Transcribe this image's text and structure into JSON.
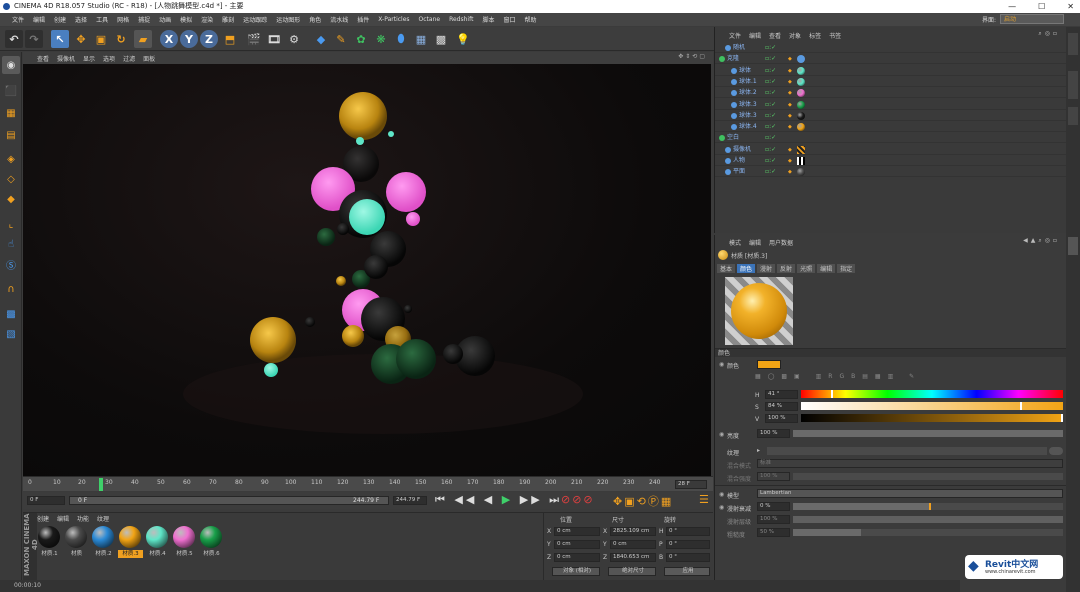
{
  "window": {
    "title": "CINEMA 4D R18.057 Studio (RC - R18) - [人物跳舞模型.c4d *] - 主要",
    "controls": [
      "—",
      "☐",
      "✕"
    ]
  },
  "menu": {
    "items": [
      "文件",
      "编辑",
      "创建",
      "选择",
      "工具",
      "网格",
      "捕捉",
      "动画",
      "模拟",
      "渲染",
      "雕刻",
      "运动跟踪",
      "运动图形",
      "角色",
      "流水线",
      "插件",
      "X-Particles",
      "Octane",
      "Redshift",
      "脚本",
      "窗口",
      "帮助"
    ],
    "interface_label": "界面:",
    "interface_value": "启动"
  },
  "viewport": {
    "menu": [
      "查看",
      "摄像机",
      "显示",
      "选项",
      "过滤",
      "面板"
    ]
  },
  "timeline": {
    "ticks": [
      "0",
      "10",
      "20",
      "30",
      "40",
      "50",
      "60",
      "70",
      "80",
      "90",
      "100",
      "110",
      "120",
      "130",
      "140",
      "150",
      "160",
      "170",
      "180",
      "190",
      "200",
      "210",
      "220",
      "230",
      "240"
    ],
    "current_frame": "28 F"
  },
  "transport": {
    "start_field": "0 F",
    "min_field": "0 F",
    "range_end": "244.79 F",
    "end_field": "244.79 F"
  },
  "materials": {
    "menu": [
      "创建",
      "编辑",
      "功能",
      "纹理"
    ],
    "items": [
      {
        "label": "材质.1",
        "color": "#1a1a1a",
        "selected": false
      },
      {
        "label": "材质",
        "color": "#4a4a4a",
        "selected": false
      },
      {
        "label": "材质.2",
        "color": "#2b8ad6",
        "selected": false
      },
      {
        "label": "材质.3",
        "color": "#f2a415",
        "selected": true
      },
      {
        "label": "材质.4",
        "color": "#5fe6c8",
        "selected": false
      },
      {
        "label": "材质.5",
        "color": "#f070d0",
        "selected": false
      },
      {
        "label": "材质.6",
        "color": "#19a04a",
        "selected": false
      }
    ],
    "brand_top": "MAXON",
    "brand_bottom": "CINEMA 4D"
  },
  "coords": {
    "headers": [
      "位置",
      "尺寸",
      "旋转"
    ],
    "rows": [
      {
        "axis": "X",
        "pos": "0 cm",
        "size_axis": "X",
        "size": "2825.109 cm",
        "rot_axis": "H",
        "rot": "0 °"
      },
      {
        "axis": "Y",
        "pos": "0 cm",
        "size_axis": "Y",
        "size": "0 cm",
        "rot_axis": "P",
        "rot": "0 °"
      },
      {
        "axis": "Z",
        "pos": "0 cm",
        "size_axis": "Z",
        "size": "1840.653 cm",
        "rot_axis": "B",
        "rot": "0 °"
      }
    ],
    "mode": "对象 (相对)",
    "size_mode": "绝对尺寸",
    "apply": "应用"
  },
  "status": {
    "time": "00:00:10"
  },
  "objects": {
    "menu": [
      "文件",
      "编辑",
      "查看",
      "对象",
      "标签",
      "书签"
    ],
    "items": [
      {
        "name": "随机",
        "indent": 1,
        "tag": "none"
      },
      {
        "name": "克隆",
        "indent": 0,
        "tag": "blue"
      },
      {
        "name": "球体",
        "indent": 2,
        "tag": "#5fe6c8"
      },
      {
        "name": "球体.1",
        "indent": 2,
        "tag": "#5fe6c8"
      },
      {
        "name": "球体.2",
        "indent": 2,
        "tag": "#f070d0"
      },
      {
        "name": "球体.3",
        "indent": 2,
        "tag": "#19a04a"
      },
      {
        "name": "球体.3",
        "indent": 2,
        "tag": "#1a1a1a"
      },
      {
        "name": "球体.4",
        "indent": 2,
        "tag": "#f2a415"
      },
      {
        "name": "空白",
        "indent": 0,
        "tag": "none"
      },
      {
        "name": "摄像机",
        "indent": 1,
        "tag": "stripes"
      },
      {
        "name": "人物",
        "indent": 1,
        "tag": "checker"
      },
      {
        "name": "平面",
        "indent": 1,
        "tag": "#4a4a4a"
      }
    ]
  },
  "attributes": {
    "menu": [
      "模式",
      "编辑",
      "用户数据"
    ],
    "material_title": "材质 [材质.3]",
    "tabs": [
      "基本",
      "颜色",
      "漫射",
      "反射",
      "光照",
      "编辑",
      "指定"
    ],
    "active_tab": "颜色",
    "section": "颜色",
    "color_label": "颜色",
    "h_label": "H",
    "h_value": "41 °",
    "s_label": "S",
    "s_value": "84 %",
    "v_label": "V",
    "v_value": "100 %",
    "brightness_label": "亮度",
    "brightness_value": "100 %",
    "texture_label": "纹理",
    "mix_mode_label": "混合模式",
    "mix_mode_value": "标准",
    "mix_strength_label": "混合强度",
    "mix_strength_value": "100 %",
    "model_label": "模型",
    "model_value": "Lambertian",
    "diffuse_falloff_label": "漫射衰减",
    "diffuse_falloff_value": "0 %",
    "diffuse_level_label": "漫射层级",
    "diffuse_level_value": "100 %",
    "roughness_label": "粗糙度",
    "roughness_value": "50 %",
    "swatch_color": "#f2a415"
  },
  "watermark": {
    "brand": "Revit中文网",
    "url": "www.chinarevit.com"
  }
}
